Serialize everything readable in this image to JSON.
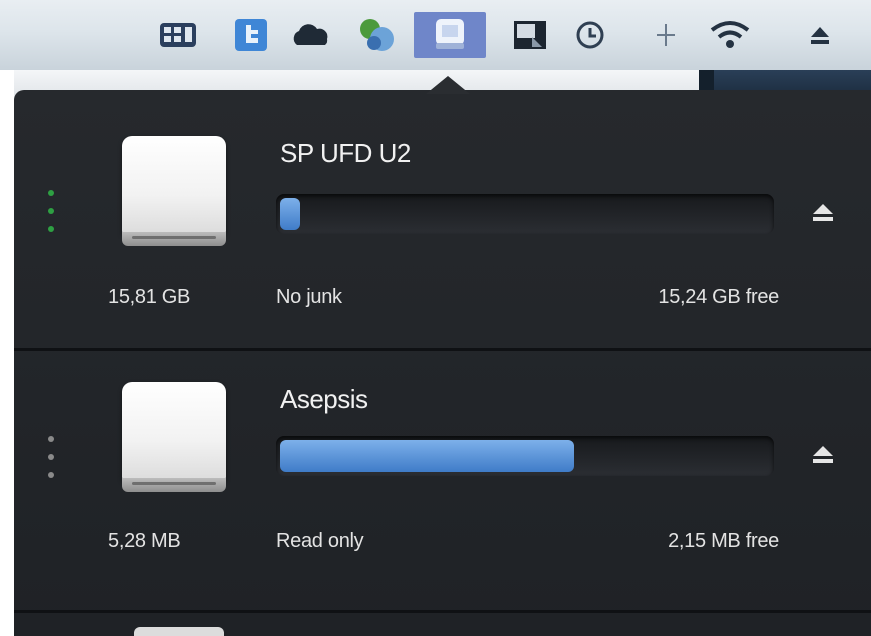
{
  "menubar": {
    "icons": [
      "layout-icon",
      "twitter-icon",
      "cloud-icon",
      "recycle-icon",
      "drive-icon",
      "screen-icon",
      "time-machine-icon",
      "bluetooth-icon",
      "wifi-icon",
      "eject-icon"
    ],
    "active_icon": "drive-icon"
  },
  "drives": [
    {
      "name": "SP UFD U2",
      "size": "15,81 GB",
      "status": "No junk",
      "free": "15,24 GB free",
      "usage_fraction": 0.04,
      "connection_indicator_color": "#2ea043"
    },
    {
      "name": "Asepsis",
      "size": "5,28 MB",
      "status": "Read only",
      "free": "2,15 MB free",
      "usage_fraction": 0.6,
      "connection_indicator_color": "#8a8a8a"
    }
  ],
  "colors": {
    "popover_background": "#24272b",
    "usage_fill": "#5b95d8",
    "text": "#f1f1f1"
  }
}
